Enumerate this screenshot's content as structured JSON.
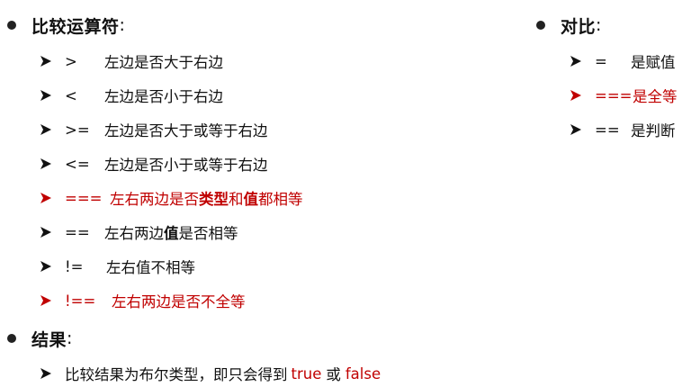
{
  "left": {
    "heading": "比较运算符",
    "heading_colon": ":",
    "items": [
      {
        "op": ">",
        "desc": "左边是否大于右边"
      },
      {
        "op": "<",
        "desc": "左边是否小于右边"
      },
      {
        "op": ">=",
        "desc": "左边是否大于或等于右边"
      },
      {
        "op": "<=",
        "desc": "左边是否小于或等于右边"
      },
      {
        "op": "===",
        "desc_a": "左右两边是否",
        "desc_b": "类型",
        "desc_c": "和",
        "desc_d": "值",
        "desc_e": "都相等"
      },
      {
        "op": "==",
        "desc_a": "左右两边",
        "desc_b": "值",
        "desc_c": "是否相等"
      },
      {
        "op": "!=",
        "desc": "左右值不相等"
      },
      {
        "op": "!==",
        "desc": "左右两边是否不全等"
      }
    ]
  },
  "right": {
    "heading": "对比",
    "heading_colon": ":",
    "items": [
      {
        "op": "=",
        "desc": "是赋值"
      },
      {
        "op": "===",
        "desc": "是全等"
      },
      {
        "op": "==",
        "desc": "是判断"
      }
    ]
  },
  "result": {
    "heading": "结果",
    "heading_colon": ":",
    "line_a": "比较结果为布尔类型，即只会得到",
    "true_word": "true",
    "or_word": "或",
    "false_word": "false"
  },
  "colors": {
    "text": "#111111",
    "accent_red": "#c00000",
    "bullet": "#222222"
  },
  "icons": {
    "bullet": "filled-circle",
    "item_marker": "arrowhead-right"
  }
}
